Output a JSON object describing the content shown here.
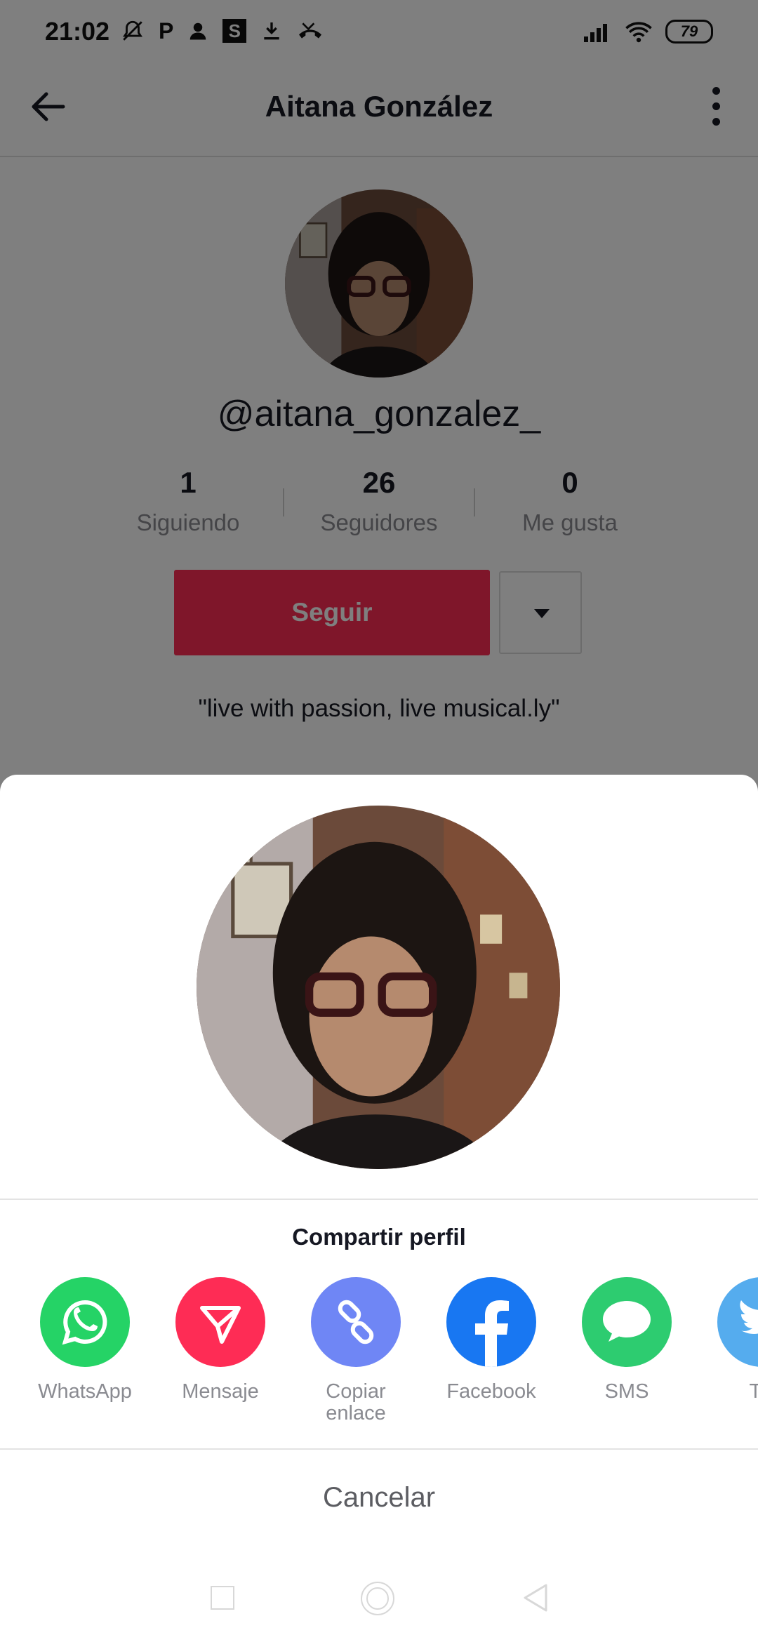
{
  "status_bar": {
    "time": "21:02",
    "left_icons": [
      "bell-off-icon",
      "P",
      "person-icon",
      "S",
      "download-icon",
      "call-missed-icon"
    ],
    "battery": "79"
  },
  "header": {
    "title": "Aitana González",
    "back_icon": "arrow-left-icon",
    "more_icon": "more-vertical-icon"
  },
  "profile": {
    "username": "@aitana_gonzalez_",
    "stats": [
      {
        "value": "1",
        "label": "Siguiendo"
      },
      {
        "value": "26",
        "label": "Seguidores"
      },
      {
        "value": "0",
        "label": "Me gusta"
      }
    ],
    "follow_label": "Seguir",
    "bio": "\"live with passion, live musical.ly\""
  },
  "share_sheet": {
    "title": "Compartir perfil",
    "options": [
      {
        "label": "WhatsApp",
        "icon": "whatsapp-icon",
        "color": "#25d366"
      },
      {
        "label": "Mensaje",
        "icon": "send-icon",
        "color": "#fe2c55"
      },
      {
        "label": "Copiar\nenlace",
        "icon": "link-icon",
        "color": "#6f86f5"
      },
      {
        "label": "Facebook",
        "icon": "facebook-icon",
        "color": "#1877f2"
      },
      {
        "label": "SMS",
        "icon": "sms-icon",
        "color": "#2dcc70"
      },
      {
        "label": "Tw",
        "icon": "twitter-icon",
        "color": "#55acee"
      }
    ],
    "cancel_label": "Cancelar"
  },
  "colors": {
    "accent": "#fe2c55",
    "text_primary": "#161823",
    "text_secondary": "#8a8b91"
  }
}
